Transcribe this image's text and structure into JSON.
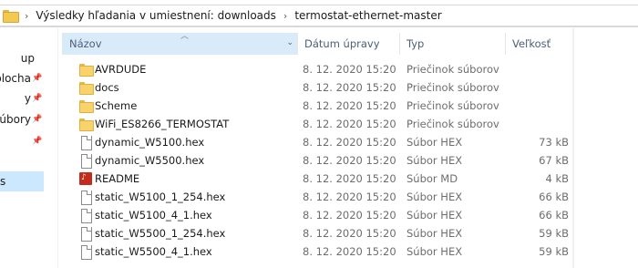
{
  "breadcrumb": {
    "items": [
      "Výsledky hľadania v umiestnení: downloads",
      "termostat-ethernet-master"
    ],
    "separator": "›"
  },
  "nav": {
    "items": [
      {
        "label": "up",
        "pinned": false
      },
      {
        "label": "plocha",
        "pinned": true
      },
      {
        "label": "y",
        "pinned": true
      },
      {
        "label": "súbory",
        "pinned": true
      },
      {
        "label": "",
        "pinned": true
      },
      {
        "label": "",
        "pinned": false
      },
      {
        "label": "s",
        "pinned": false,
        "selected": true
      }
    ]
  },
  "columns": {
    "name": "Názov",
    "date": "Dátum úpravy",
    "type": "Typ",
    "size": "Veľkosť"
  },
  "files": [
    {
      "name": "AVRDUDE",
      "date": "8. 12. 2020 15:20",
      "type": "Priečinok súborov",
      "size": "",
      "icon": "folder-icon"
    },
    {
      "name": "docs",
      "date": "8. 12. 2020 15:20",
      "type": "Priečinok súborov",
      "size": "",
      "icon": "folder-icon"
    },
    {
      "name": "Scheme",
      "date": "8. 12. 2020 15:20",
      "type": "Priečinok súborov",
      "size": "",
      "icon": "folder-icon"
    },
    {
      "name": "WiFi_ES8266_TERMOSTAT",
      "date": "8. 12. 2020 15:20",
      "type": "Priečinok súborov",
      "size": "",
      "icon": "folder-icon"
    },
    {
      "name": "dynamic_W5100.hex",
      "date": "8. 12. 2020 15:20",
      "type": "Súbor HEX",
      "size": "73 kB",
      "icon": "file-icon"
    },
    {
      "name": "dynamic_W5500.hex",
      "date": "8. 12. 2020 15:20",
      "type": "Súbor HEX",
      "size": "67 kB",
      "icon": "file-icon"
    },
    {
      "name": "README",
      "date": "8. 12. 2020 15:20",
      "type": "Súbor MD",
      "size": "4 kB",
      "icon": "markdown-file-icon"
    },
    {
      "name": "static_W5100_1_254.hex",
      "date": "8. 12. 2020 15:20",
      "type": "Súbor HEX",
      "size": "66 kB",
      "icon": "file-icon"
    },
    {
      "name": "static_W5100_4_1.hex",
      "date": "8. 12. 2020 15:20",
      "type": "Súbor HEX",
      "size": "66 kB",
      "icon": "file-icon"
    },
    {
      "name": "static_W5500_1_254.hex",
      "date": "8. 12. 2020 15:20",
      "type": "Súbor HEX",
      "size": "59 kB",
      "icon": "file-icon"
    },
    {
      "name": "static_W5500_4_1.hex",
      "date": "8. 12. 2020 15:20",
      "type": "Súbor HEX",
      "size": "59 kB",
      "icon": "file-icon"
    }
  ],
  "colors": {
    "header_text": "#4c607a",
    "sorted_header_bg": "#d9ebf9",
    "selected_nav_bg": "#cce8ff",
    "folder_yellow": "#f8d26a"
  }
}
